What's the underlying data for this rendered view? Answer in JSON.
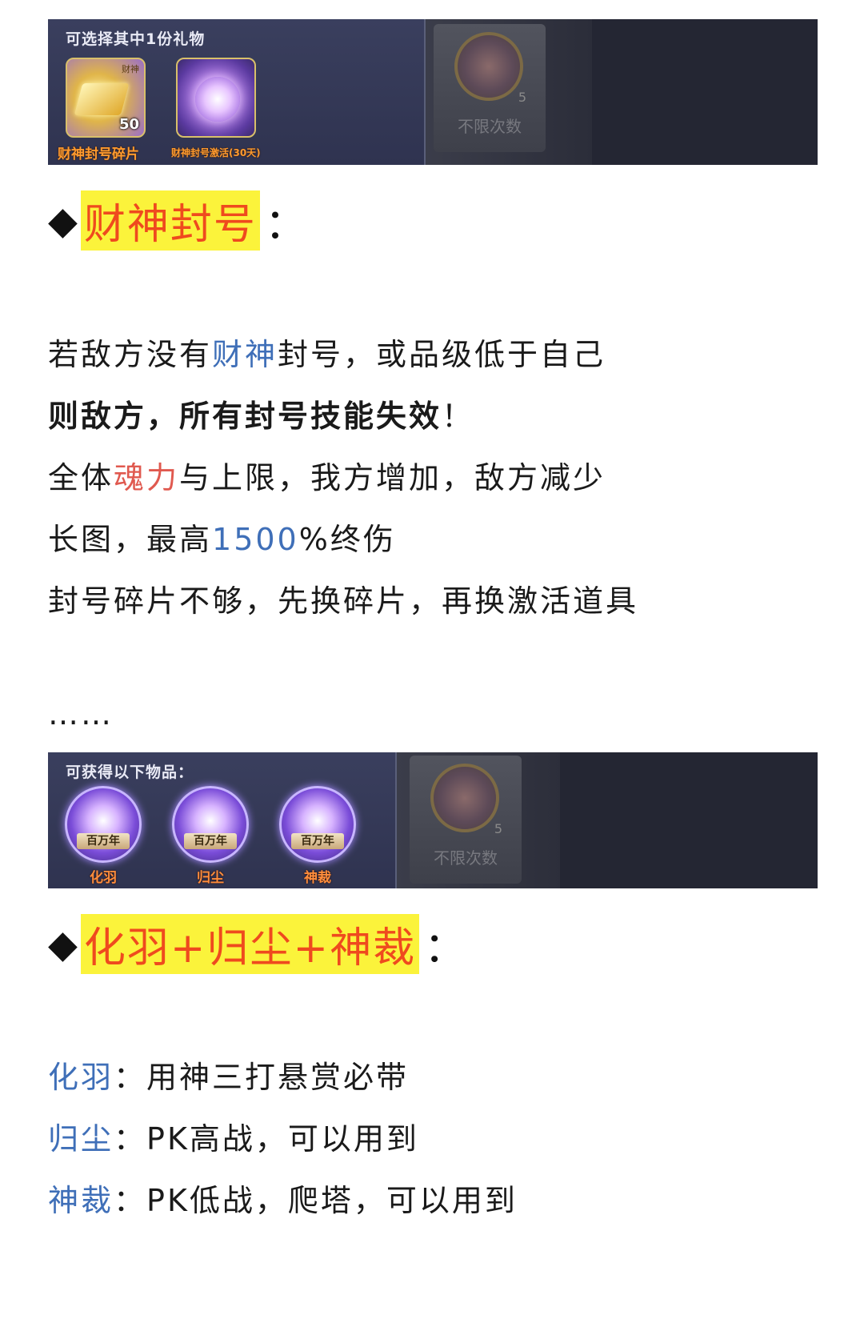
{
  "banner1": {
    "header": "可选择其中1份礼物",
    "items": [
      {
        "icon": "gold-ingot-icon",
        "tag": "财神",
        "qty": "50",
        "label": "财神封号碎片"
      },
      {
        "icon": "purple-emblem-icon",
        "label": "财神封号激活(30天)"
      }
    ],
    "locked": {
      "icon": "medal-icon",
      "count": "5",
      "text": "不限次数"
    }
  },
  "section1": {
    "title": "财神封号",
    "colon": "：",
    "lines": [
      {
        "parts": [
          "若敌方没有",
          "财神",
          "封号，或品级低于自己"
        ]
      },
      {
        "parts": [
          "则敌方，所有封号技能失效",
          "！"
        ]
      },
      {
        "parts": [
          "全体",
          "魂力",
          "与上限，我方增加，敌方减少"
        ]
      },
      {
        "parts": [
          "长图，最高",
          "1500",
          "%终伤"
        ]
      },
      {
        "parts": [
          "封号碎片不够，先换碎片，再换激活道具"
        ]
      }
    ],
    "ellipsis": "……"
  },
  "banner2": {
    "header": "可获得以下物品：",
    "items": [
      {
        "icon": "orb-icon",
        "ribbon": "百万年",
        "label": "化羽"
      },
      {
        "icon": "orb-icon",
        "ribbon": "百万年",
        "label": "归尘"
      },
      {
        "icon": "orb-icon",
        "ribbon": "百万年",
        "label": "神裁"
      }
    ],
    "locked": {
      "icon": "medal-icon",
      "count": "5",
      "text": "不限次数"
    }
  },
  "section2": {
    "title": "化羽+归尘+神裁",
    "colon": "：",
    "lines": [
      {
        "name": "化羽",
        "sep": "：",
        "text": "用神三打悬赏必带"
      },
      {
        "name": "归尘",
        "sep": "：",
        "text": "PK高战，可以用到"
      },
      {
        "name": "神裁",
        "sep": "：",
        "text": "PK低战，爬塔，可以用到"
      }
    ]
  },
  "colors": {
    "highlight": "#fbf33b",
    "heading_text": "#ef4a1e",
    "blue": "#3f6fb8",
    "red": "#e0594f"
  }
}
